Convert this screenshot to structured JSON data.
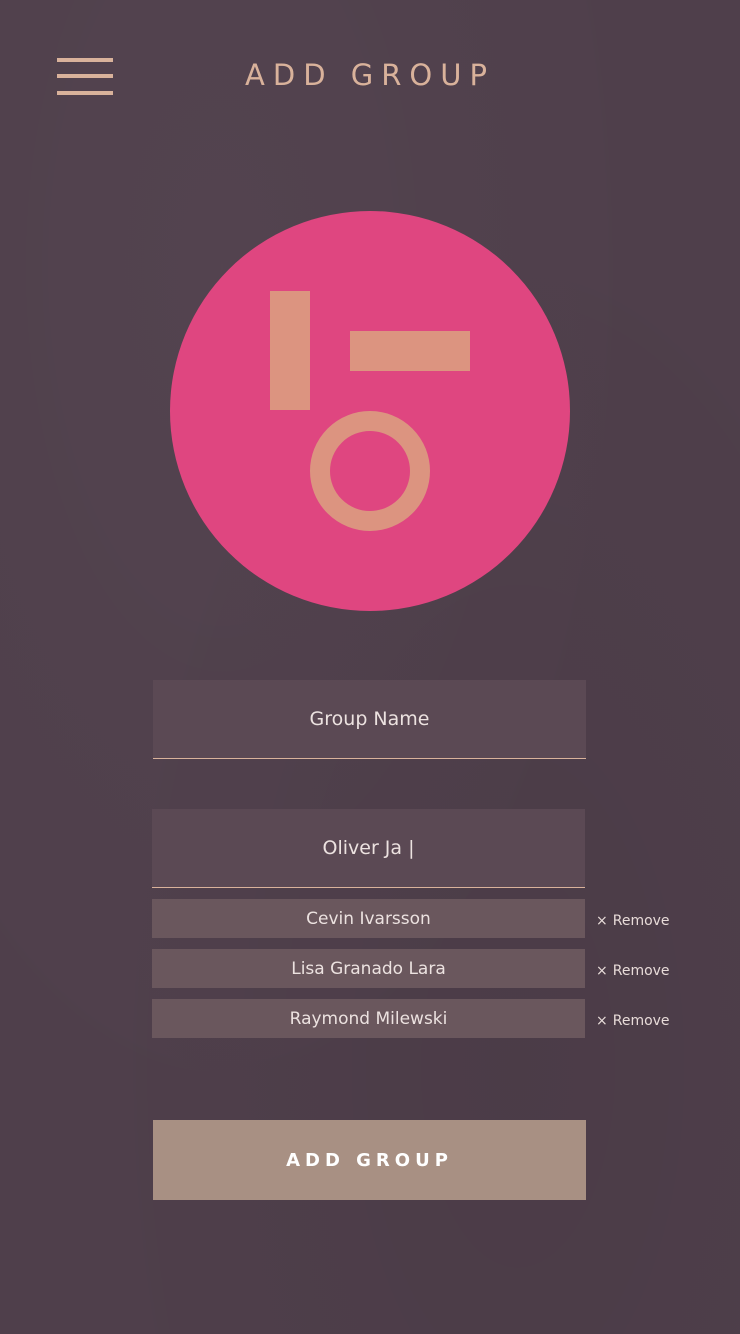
{
  "header": {
    "title": "ADD GROUP",
    "menu_icon": "hamburger-menu-icon"
  },
  "avatar": {
    "background_color": "#df4680",
    "shape_color": "#dc9480"
  },
  "form": {
    "group_name": {
      "placeholder": "Group Name",
      "value": ""
    },
    "member_search": {
      "value": "Oliver Ja |"
    },
    "members": [
      {
        "name": "Cevin Ivarsson",
        "remove_label": "Remove",
        "remove_icon": "×"
      },
      {
        "name": "Lisa Granado Lara",
        "remove_label": "Remove",
        "remove_icon": "×"
      },
      {
        "name": "Raymond Milewski",
        "remove_label": "Remove",
        "remove_icon": "×"
      }
    ],
    "submit_label": "ADD GROUP"
  },
  "colors": {
    "background": "#4f3f4b",
    "accent": "#d9b29b",
    "button": "#a89083"
  }
}
